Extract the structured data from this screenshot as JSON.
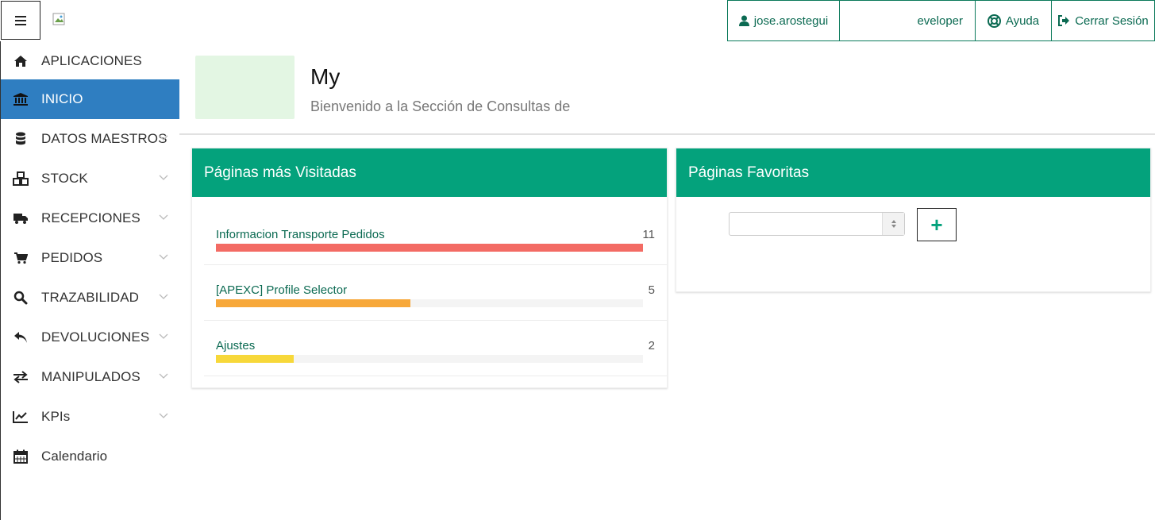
{
  "topbar": {
    "menu_icon": "hamburger-icon",
    "user": {
      "icon": "user-icon",
      "label": "jose.arostegui"
    },
    "role": {
      "label": "eveloper"
    },
    "help": {
      "icon": "lifebuoy-icon",
      "label": "Ayuda"
    },
    "logout": {
      "icon": "sign-out-icon",
      "label": "Cerrar Sesión"
    }
  },
  "sidebar": {
    "items": [
      {
        "label": "APLICACIONES",
        "icon": "home-icon",
        "active": false,
        "expandable": false
      },
      {
        "label": "INICIO",
        "icon": "bank-icon",
        "active": true,
        "expandable": false
      },
      {
        "label": "DATOS MAESTROS",
        "icon": "database-icon",
        "active": false,
        "expandable": true
      },
      {
        "label": "STOCK",
        "icon": "cubes-icon",
        "active": false,
        "expandable": true
      },
      {
        "label": "RECEPCIONES",
        "icon": "truck-icon",
        "active": false,
        "expandable": true
      },
      {
        "label": "PEDIDOS",
        "icon": "cart-icon",
        "active": false,
        "expandable": true
      },
      {
        "label": "TRAZABILIDAD",
        "icon": "search-icon",
        "active": false,
        "expandable": true
      },
      {
        "label": "DEVOLUCIONES",
        "icon": "reply-icon",
        "active": false,
        "expandable": true
      },
      {
        "label": "MANIPULADOS",
        "icon": "exchange-icon",
        "active": false,
        "expandable": true
      },
      {
        "label": "KPIs",
        "icon": "line-chart-icon",
        "active": false,
        "expandable": true
      },
      {
        "label": "Calendario",
        "icon": "calendar-icon",
        "active": false,
        "expandable": false
      }
    ]
  },
  "header": {
    "title": "My",
    "subtitle": "Bienvenido a la Sección de Consultas de"
  },
  "most_visited": {
    "title": "Páginas más Visitadas",
    "items": [
      {
        "name": "Informacion Transporte Pedidos",
        "count": "11",
        "fraction": 1.0,
        "color": "#f36b64"
      },
      {
        "name": "[APEXC] Profile Selector",
        "count": "5",
        "fraction": 0.4545,
        "color": "#f7a83a"
      },
      {
        "name": "Ajustes",
        "count": "2",
        "fraction": 0.1818,
        "color": "#f7d83a"
      }
    ]
  },
  "favorites": {
    "title": "Páginas Favoritas",
    "select_value": "",
    "add_icon": "plus-icon",
    "add_label": "+"
  },
  "colors": {
    "accent": "#04a27c",
    "active_nav": "#2f7ec1",
    "link": "#0b6a52"
  }
}
